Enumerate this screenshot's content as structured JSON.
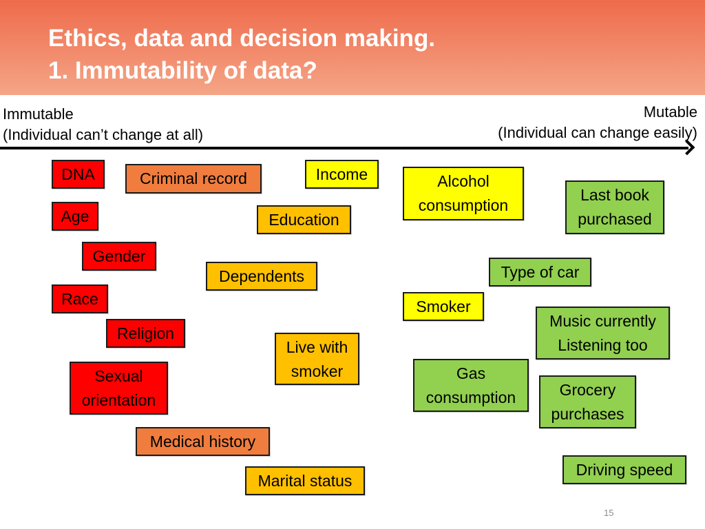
{
  "header": {
    "title_line1": "Ethics, data and decision making.",
    "title_line2": "1. Immutability of data?"
  },
  "axis": {
    "left_label": "Immutable",
    "left_sub": "(Individual can’t change at all)",
    "right_label": "Mutable",
    "right_sub": "(Individual can change easily)"
  },
  "colors": {
    "red": "#ff0000",
    "orange": "#f07d3e",
    "amber": "#ffc000",
    "yellow": "#ffff00",
    "green": "#92d050"
  },
  "items": [
    {
      "label": "DNA",
      "color": "#ff0000"
    },
    {
      "label": "Criminal record",
      "color": "#f07d3e"
    },
    {
      "label": "Income",
      "color": "#ffff00"
    },
    {
      "label": "Alcohol consumption",
      "color": "#ffff00"
    },
    {
      "label": "Last book purchased",
      "color": "#92d050"
    },
    {
      "label": "Age",
      "color": "#ff0000"
    },
    {
      "label": "Education",
      "color": "#ffc000"
    },
    {
      "label": "Gender",
      "color": "#ff0000"
    },
    {
      "label": "Dependents",
      "color": "#ffc000"
    },
    {
      "label": "Type of car",
      "color": "#92d050"
    },
    {
      "label": "Race",
      "color": "#ff0000"
    },
    {
      "label": "Smoker",
      "color": "#ffff00"
    },
    {
      "label": "Music currently Listening too",
      "color": "#92d050"
    },
    {
      "label": "Religion",
      "color": "#ff0000"
    },
    {
      "label": "Live with smoker",
      "color": "#ffc000"
    },
    {
      "label": "Sexual orientation",
      "color": "#ff0000"
    },
    {
      "label": "Gas consumption",
      "color": "#92d050"
    },
    {
      "label": "Grocery purchases",
      "color": "#92d050"
    },
    {
      "label": "Medical history",
      "color": "#f07d3e"
    },
    {
      "label": "Driving speed",
      "color": "#92d050"
    },
    {
      "label": "Marital status",
      "color": "#ffc000"
    }
  ],
  "page_number": "15"
}
